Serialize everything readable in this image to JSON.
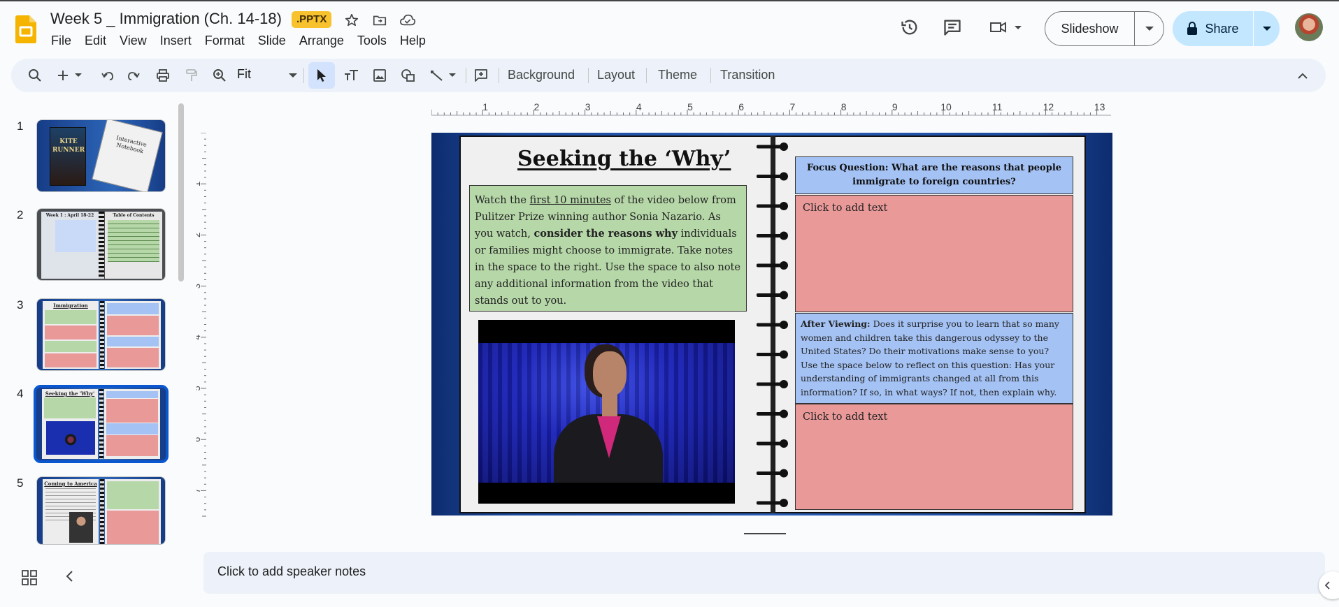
{
  "app": {
    "doc_title": "Week 5 _ Immigration (Ch. 14-18)",
    "file_badge": ".PPTX",
    "menu": [
      "File",
      "Edit",
      "View",
      "Insert",
      "Format",
      "Slide",
      "Arrange",
      "Tools",
      "Help"
    ],
    "slideshow_label": "Slideshow",
    "share_label": "Share",
    "accent_color": "#0b57d0",
    "share_bg": "#c2e7ff"
  },
  "toolbar": {
    "zoom_value": "Fit",
    "background_label": "Background",
    "layout_label": "Layout",
    "theme_label": "Theme",
    "transition_label": "Transition"
  },
  "filmstrip": {
    "slides": [
      {
        "number": "1",
        "title": "Kite Runner / Interactive Notebook",
        "kite_text": "KITE RUNNER",
        "notebook_text": "Interactive Notebook"
      },
      {
        "number": "2",
        "title": "Week 1 : April 18-22 / Table of Contents",
        "left_title": "Week 1 : April 18-22",
        "right_title": "Table of Contents"
      },
      {
        "number": "3",
        "title": "Immigration"
      },
      {
        "number": "4",
        "title": "Seeking the 'Why'",
        "selected": true
      },
      {
        "number": "5",
        "title": "Coming to America"
      }
    ]
  },
  "ruler": {
    "h_labels": [
      "1",
      "2",
      "3",
      "4",
      "5",
      "6",
      "7",
      "8",
      "9",
      "10",
      "11",
      "12",
      "13"
    ],
    "v_labels": [
      "1",
      "2",
      "3",
      "4",
      "5",
      "6",
      "7"
    ]
  },
  "slide": {
    "title": "Seeking the ‘Why’",
    "instructions": {
      "p1": "Watch the ",
      "underline": "first 10 minutes",
      "p2": " of the  video below from Pulitzer Prize winning author Sonia Nazario. As you watch, ",
      "bold": "consider the reasons why",
      "p3": " individuals or families might choose to immigrate. Take notes in the space to the right. Use the space to also note any additional information from the video that stands out to you."
    },
    "focus_question": "Focus Question: What are the reasons that people immigrate to foreign countries?",
    "placeholder_1": "Click to add text",
    "after_viewing_label": "After Viewing:",
    "after_viewing_text": " Does it surprise you to learn that so many women and children take this dangerous odyssey to the United States? Do their motivations make sense to you? Use the space below to reflect on this question: Has your understanding of immigrants changed at all from this information? If so, in what ways? If not, then explain why.",
    "placeholder_2": "Click to add text",
    "colors": {
      "green": "#b6d7a8",
      "blue": "#a4c2f4",
      "pink": "#ea9999"
    }
  },
  "notes": {
    "placeholder": "Click to add speaker notes"
  }
}
